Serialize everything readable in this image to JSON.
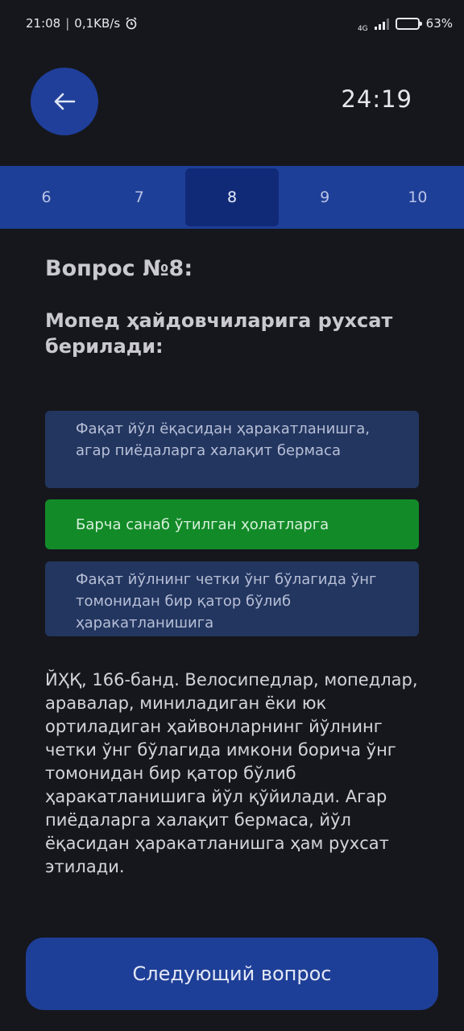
{
  "status_bar": {
    "time": "21:08",
    "separator": "|",
    "net_speed": "0,1KB/s",
    "network_label": "4G",
    "battery": "63%",
    "battery_level": 0.63,
    "icons": [
      "alarm-icon",
      "signal-icon",
      "battery-icon"
    ]
  },
  "header": {
    "back_icon": "arrow-left-icon",
    "timer": "24:19"
  },
  "pager": {
    "tabs": [
      "6",
      "7",
      "8",
      "9",
      "10"
    ],
    "active_index": 2
  },
  "question": {
    "number_label": "Вопрос №8:",
    "text": "Мопед ҳайдовчиларига рухсат берилади:"
  },
  "answers": [
    {
      "text": "Фақат йўл ёқасидан ҳаракатланишга, агар пиёдаларга халақит бермаса",
      "state": "default"
    },
    {
      "text": "Барча санаб ўтилган ҳолатларга",
      "state": "correct"
    },
    {
      "text": "Фақат йўлнинг четки ўнг бўлагида ўнг томонидан бир қатор бўлиб ҳаракатланишига",
      "state": "default"
    }
  ],
  "explanation": "ЙҲҚ, 166-банд. Велосипедлар, мопедлар, аравалар, миниладиган ёки юк ортиладиган ҳайвонларнинг йўлнинг четки ўнг бўлагида имкони борича ўнг томонидан бир қатор бўлиб ҳаракатланишига йўл қўйилади. Агар пиёдаларга халақит бермаса, йўл ёқасидан ҳаракатланишга ҳам рухсат этилади.",
  "next_button": "Следующий вопрос",
  "colors": {
    "background": "#16171d",
    "primary_blue": "#1e3f97",
    "active_tab": "#102a78",
    "answer_bg": "#233660",
    "correct_green": "#128a28"
  }
}
